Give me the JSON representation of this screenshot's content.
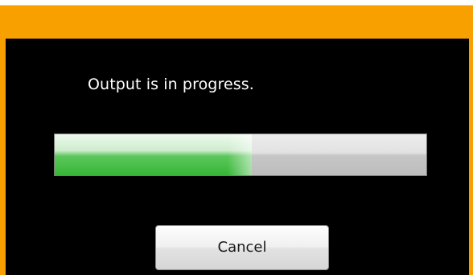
{
  "dialog": {
    "message": "Output is in progress.",
    "progress": 0.53,
    "cancel_label": "Cancel"
  },
  "colors": {
    "frame": "#f8a000",
    "background": "#000000",
    "progress_fill": "#4cc04c",
    "progress_track": "#c8c8c8"
  }
}
